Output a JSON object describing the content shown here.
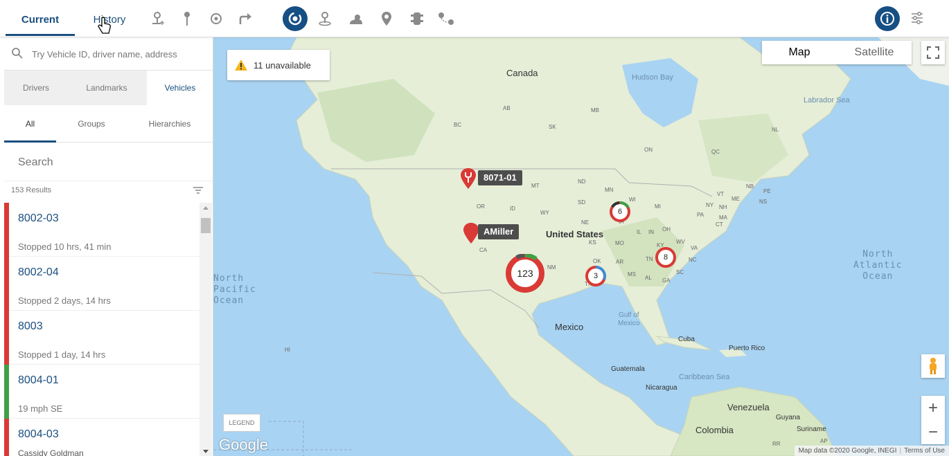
{
  "toolbar": {
    "tabs": [
      {
        "label": "Current",
        "selected": true
      },
      {
        "label": "History",
        "selected": false
      }
    ],
    "tools": [
      {
        "icon": "add-location-icon"
      },
      {
        "icon": "pin-icon"
      },
      {
        "icon": "crosshair-icon"
      },
      {
        "icon": "redirect-arrow-icon"
      },
      {
        "icon": "live-tracking-icon",
        "active": true
      },
      {
        "icon": "landmark-icon"
      },
      {
        "icon": "weather-icon"
      },
      {
        "icon": "map-marker-icon"
      },
      {
        "icon": "traffic-light-icon"
      },
      {
        "icon": "route-icon"
      }
    ],
    "accent": "#164f83"
  },
  "sidebar": {
    "search_placeholder": "Try Vehicle ID, driver name, address",
    "tabs": [
      "Drivers",
      "Landmarks",
      "Vehicles"
    ],
    "subtabs": [
      "All",
      "Groups",
      "Hierarchies"
    ],
    "list_search_placeholder": "Search",
    "results": "153 Results",
    "vehicles": [
      {
        "id": "8002-03",
        "status": "Stopped 10 hrs, 41 min",
        "driver": "",
        "color": "#d93a35"
      },
      {
        "id": "8002-04",
        "status": "Stopped 2 days, 14 hrs",
        "driver": "",
        "color": "#d93a35"
      },
      {
        "id": "8003",
        "status": "Stopped 1 day, 14 hrs",
        "driver": "",
        "color": "#d93a35"
      },
      {
        "id": "8004-01",
        "status": "19 mph SE",
        "driver": "",
        "color": "#3fa046"
      },
      {
        "id": "8004-03",
        "status": "",
        "driver": "Cassidy Goldman",
        "color": "#d93a35"
      }
    ]
  },
  "map": {
    "unavailable": "11 unavailable",
    "map_type": {
      "map": "Map",
      "satellite": "Satellite"
    },
    "legend": "LEGEND",
    "google": "Google",
    "attribution": "Map data ©2020 Google, INEGI",
    "terms": "Terms of Use",
    "places": {
      "canada": "Canada",
      "hudson_bay": "Hudson Bay",
      "labrador_sea": "Labrador Sea",
      "united_states": "United States",
      "mexico": "Mexico",
      "gulf": "Gulf of\nMexico",
      "cuba": "Cuba",
      "puerto_rico": "Puerto Rico",
      "guatemala": "Guatemala",
      "caribbean": "Caribbean Sea",
      "nicaragua": "Nicaragua",
      "venezuela": "Venezuela",
      "colombia": "Colombia",
      "guyana": "Guyana",
      "suriname": "Suriname",
      "north_pacific": "North\nPacific\nOcean",
      "north_atlantic": "North\nAtlantic\nOcean"
    },
    "states": [
      "AB",
      "MB",
      "BC",
      "SK",
      "ON",
      "QC",
      "NL",
      "MT",
      "ND",
      "MN",
      "WI",
      "MI",
      "OR",
      "ID",
      "WY",
      "SD",
      "NE",
      "IA",
      "IL",
      "IN",
      "OH",
      "PA",
      "NY",
      "ME",
      "NB",
      "PE",
      "NS",
      "NH",
      "MA",
      "KS",
      "MO",
      "KY",
      "WV",
      "VA",
      "NC",
      "TN",
      "OK",
      "AR",
      "MS",
      "AL",
      "GA",
      "SC",
      "TX",
      "NM",
      "CA",
      "HI",
      "CT",
      "RR",
      "AP",
      "VT"
    ],
    "callouts": [
      {
        "label": "8071-01",
        "icon": "wrench-marker-icon"
      },
      {
        "label": "AMiller",
        "icon": "vehicle-marker-icon"
      }
    ],
    "clusters": [
      {
        "count": "123"
      },
      {
        "count": "6"
      },
      {
        "count": "3"
      },
      {
        "count": "8"
      }
    ],
    "colors": {
      "water": "#a9d3f2",
      "land": "#e8f0dc",
      "red": "#d93a35",
      "green": "#3fa046",
      "blue": "#3b8fd6"
    }
  }
}
